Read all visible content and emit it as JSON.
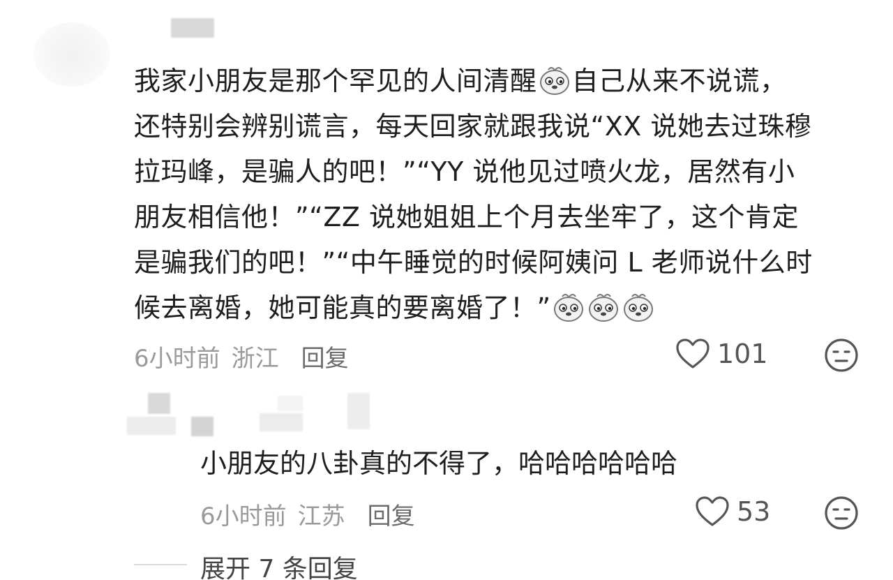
{
  "main_comment": {
    "lines": [
      [
        "我家小朋友是那个罕见的人间清醒",
        "自己从来不说谎，"
      ],
      [
        "还特别会辨别谎言，每天回家就跟我说“XX 说她去过珠穆"
      ],
      [
        "拉玛峰，是骗人的吧！”“YY 说他见过喷火龙，居然有小"
      ],
      [
        "朋友相信他！”“ZZ 说她姐姐上个月去坐牢了，这个肯定"
      ],
      [
        "是骗我们的吧！”“中午睡觉的时候阿姨问 L 老师说什么时"
      ],
      [
        "候去离婚，她可能真的要离婚了！”"
      ]
    ],
    "time": "6小时前",
    "location": "浙江",
    "reply_label": "回复",
    "like_count": "101",
    "emoji_icon": "dog-face-emoji-icon"
  },
  "reply_comment": {
    "text": "小朋友的八卦真的不得了，哈哈哈哈哈哈",
    "time": "6小时前",
    "location": "江苏",
    "reply_label": "回复",
    "like_count": "53"
  },
  "expand": {
    "label": "展开 7 条回复"
  }
}
